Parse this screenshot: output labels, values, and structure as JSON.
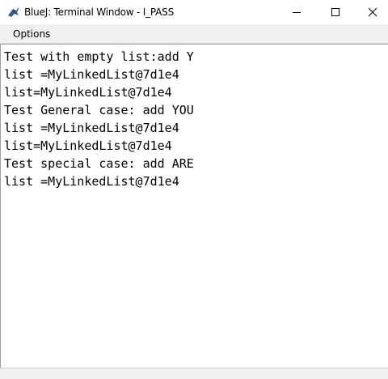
{
  "window": {
    "title": "BlueJ: Terminal Window - I_PASS",
    "app_icon": "bluej-bird-icon",
    "controls": {
      "minimize_icon": "minimize-icon",
      "maximize_icon": "maximize-icon",
      "close_icon": "close-icon"
    }
  },
  "menubar": {
    "items": [
      {
        "label": "Options"
      }
    ]
  },
  "terminal": {
    "lines": [
      "Test with empty list:add Y",
      "list =MyLinkedList@7d1e4",
      "list=MyLinkedList@7d1e4",
      "Test General case: add YOU",
      "list =MyLinkedList@7d1e4",
      "list=MyLinkedList@7d1e4",
      "Test special case: add ARE",
      "list =MyLinkedList@7d1e4"
    ]
  }
}
